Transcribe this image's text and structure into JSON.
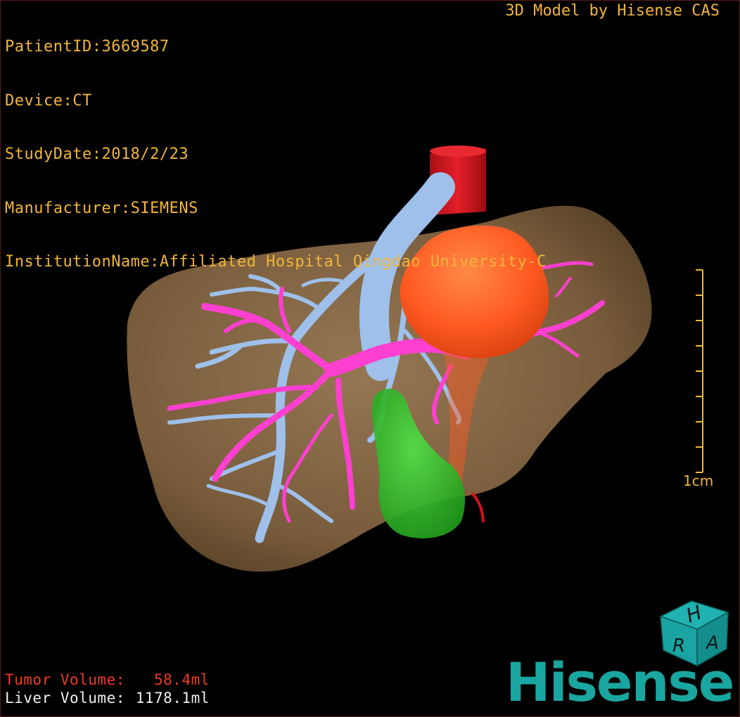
{
  "info": {
    "patient_id": "PatientID:3669587",
    "device": "Device:CT",
    "study_date": "StudyDate:2018/2/23",
    "manufacturer": "Manufacturer:SIEMENS",
    "institution": "InstitutionName:Affiliated Hospital Qingdao University-C"
  },
  "credit": "3D Model by Hisense CAS",
  "scale_bar": {
    "label": "1cm"
  },
  "volumes": {
    "tumor_label": "Tumor Volume:",
    "tumor_value": "58.4ml",
    "liver_label": "Liver Volume:",
    "liver_value": "1178.1ml"
  },
  "orientation_cube": {
    "letters": [
      "H",
      "R",
      "A"
    ]
  },
  "brand": "Hisense",
  "colors": {
    "text": "#f2b53a",
    "tumor_text": "#ee3b24",
    "liver": "#8a6a45",
    "tumor": "#ff5a22",
    "portal_vein": "#ff3fd0",
    "hepatic_vein": "#9ec0ea",
    "gallbladder": "#2fc22a",
    "ivc": "#d4141b",
    "brand": "#1aa6a0"
  }
}
